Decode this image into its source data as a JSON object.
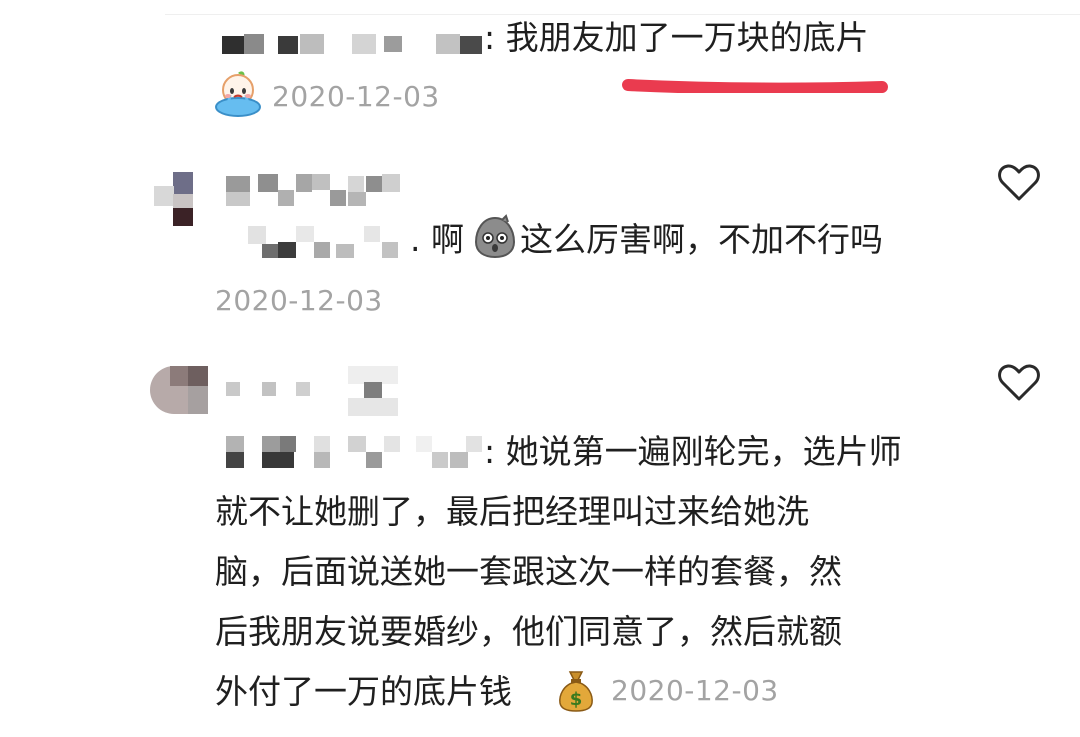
{
  "comments": [
    {
      "reply_text": ": 我朋友加了一万块的底片",
      "reaction_icon": "crying-face-emoji",
      "date": "2020-12-03"
    },
    {
      "reply_prefix": ". 啊",
      "reply_text": "这么厉害啊，不加不行吗",
      "emoji_icon": "shocked-face-emoji",
      "date": "2020-12-03",
      "like_icon": "heart-outline-icon"
    },
    {
      "reply_lines": [
        ": 她说第一遍刚轮完，选片师",
        "就不让她删了，最后把经理叫过来给她洗",
        "脑，后面说送她一套跟这次一样的套餐，然",
        "后我朋友说要婚纱，他们同意了，然后就额",
        "外付了一万的底片钱"
      ],
      "emoji_icon": "money-bag-emoji",
      "date": "2020-12-03",
      "like_icon": "heart-outline-icon"
    }
  ],
  "colors": {
    "text": "#1f1f1f",
    "meta": "#a3a3a3",
    "highlight": "#ea3b4f"
  }
}
